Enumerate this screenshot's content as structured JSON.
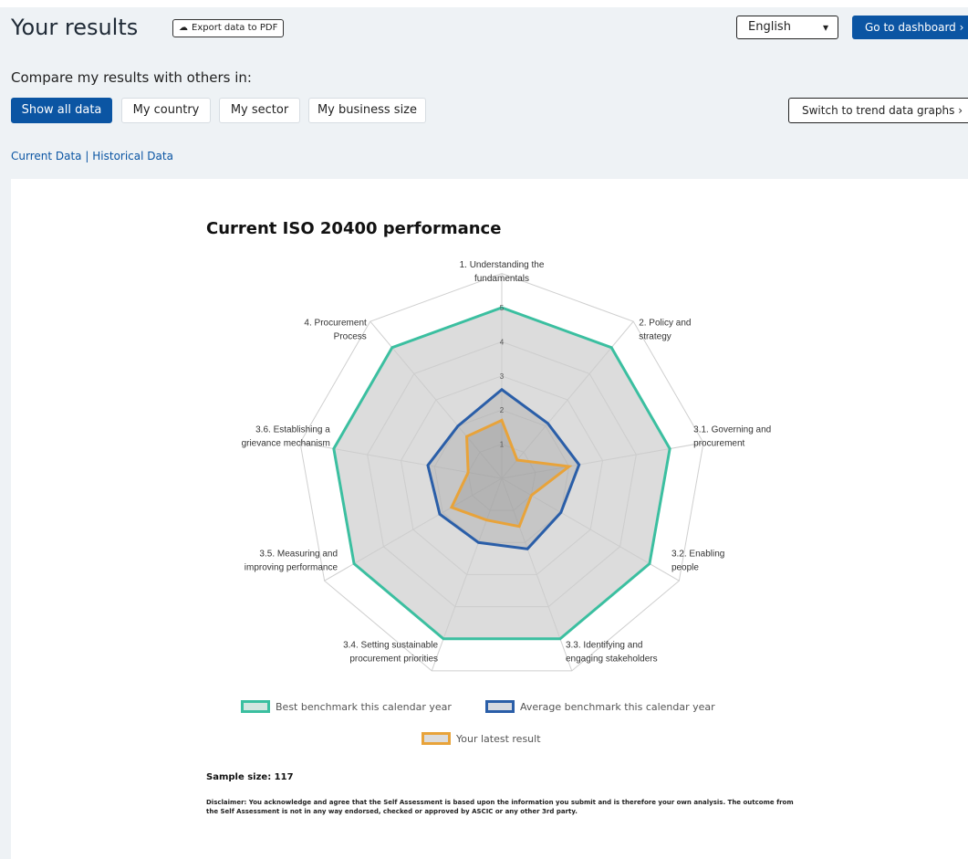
{
  "header": {
    "title": "Your results",
    "export_label": "Export data to PDF",
    "language": "English",
    "dashboard_label": "Go to dashboard",
    "dashboard_arrow": "›"
  },
  "compare": {
    "label": "Compare my results with others in:",
    "filters": [
      "Show all data",
      "My country",
      "My sector",
      "My business size"
    ],
    "active_filter": "Show all data",
    "trend_label": "Switch to trend data graphs",
    "trend_arrow": "›"
  },
  "data_links": {
    "current": "Current Data",
    "separator": "|",
    "historical": "Historical Data"
  },
  "colors": {
    "primary": "#0b55a3",
    "best": "#3bbfa0",
    "average": "#2a5ea8",
    "latest": "#e8a33a"
  },
  "chart_data": {
    "type": "radar",
    "title": "Current ISO 20400 performance",
    "categories": [
      "1. Understanding the fundamentals",
      "2. Policy and strategy",
      "3.1. Governing and procurement",
      "3.2. Enabling people",
      "3.3. Identifying and engaging stakeholders",
      "3.4. Setting sustainable procurement priorities",
      "3.5. Measuring and improving performance",
      "3.6. Establishing a grievance mechanism",
      "4. Procurement Process"
    ],
    "category_lines": [
      [
        "1. Understanding the",
        "fundamentals"
      ],
      [
        "2. Policy and",
        "strategy"
      ],
      [
        "3.1. Governing and",
        "procurement"
      ],
      [
        "3.2. Enabling",
        "people"
      ],
      [
        "3.3. Identifying and",
        "engaging stakeholders"
      ],
      [
        "3.4. Setting sustainable",
        "procurement priorities"
      ],
      [
        "3.5. Measuring and",
        "improving performance"
      ],
      [
        "3.6. Establishing a",
        "grievance mechanism"
      ],
      [
        "4. Procurement",
        "Process"
      ]
    ],
    "range": [
      0,
      5
    ],
    "ticks": [
      "1",
      "2",
      "3",
      "4",
      "5"
    ],
    "series": [
      {
        "name": "Best benchmark this calendar year",
        "values": [
          5,
          5,
          5,
          5,
          5,
          5,
          5,
          5,
          5
        ]
      },
      {
        "name": "Average benchmark this calendar year",
        "values": [
          2.6,
          2.1,
          2.3,
          2.0,
          2.2,
          2.0,
          2.1,
          2.2,
          2.0
        ]
      },
      {
        "name": "Your latest result",
        "values": [
          1.7,
          0.7,
          2.0,
          1.0,
          1.5,
          1.3,
          1.7,
          1.0,
          1.6
        ]
      }
    ]
  },
  "sample": "Sample size: 117",
  "disclaimer": "Disclaimer: You acknowledge and agree that the Self Assessment is based upon the information you submit and is therefore your own analysis. The outcome from the Self Assessment is not in any way endorsed, checked or approved by ASCIC or any other 3rd party."
}
